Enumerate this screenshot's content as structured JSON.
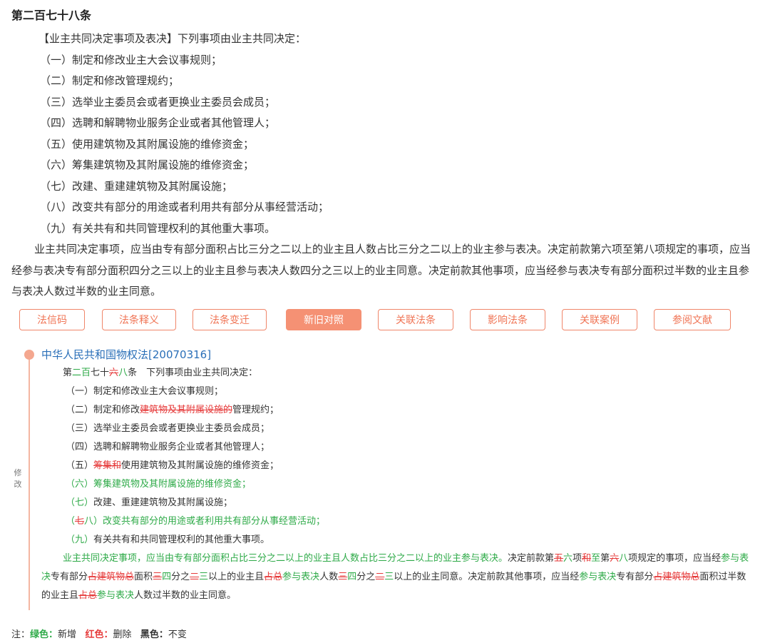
{
  "article": {
    "title": "第二百七十八条",
    "intro": "【业主共同决定事项及表决】下列事项由业主共同决定：",
    "items": [
      "（一）制定和修改业主大会议事规则；",
      "（二）制定和修改管理规约；",
      "（三）选举业主委员会或者更换业主委员会成员；",
      "（四）选聘和解聘物业服务企业或者其他管理人；",
      "（五）使用建筑物及其附属设施的维修资金；",
      "（六）筹集建筑物及其附属设施的维修资金；",
      "（七）改建、重建建筑物及其附属设施；",
      "（八）改变共有部分的用途或者利用共有部分从事经营活动；",
      "（九）有关共有和共同管理权利的其他重大事项。"
    ],
    "paragraph": "业主共同决定事项，应当由专有部分面积占比三分之二以上的业主且人数占比三分之二以上的业主参与表决。决定前款第六项至第八项规定的事项，应当经参与表决专有部分面积四分之三以上的业主且参与表决人数四分之三以上的业主同意。决定前款其他事项，应当经参与表决专有部分面积过半数的业主且参与表决人数过半数的业主同意。"
  },
  "tabs": [
    {
      "label": "法信码",
      "active": false
    },
    {
      "label": "法条释义",
      "active": false
    },
    {
      "label": "法条变迁",
      "active": false
    },
    {
      "label": "新旧对照",
      "active": true
    },
    {
      "label": "关联法条",
      "active": false
    },
    {
      "label": "影响法条",
      "active": false
    },
    {
      "label": "关联案例",
      "active": false
    },
    {
      "label": "参阅文献",
      "active": false
    }
  ],
  "comparison": {
    "side_label": "修改",
    "law_title": "中华人民共和国物权法[20070316]",
    "head": [
      {
        "t": "第"
      },
      {
        "t": "二百",
        "c": "g"
      },
      {
        "t": "七十"
      },
      {
        "t": "六",
        "c": "r"
      },
      {
        "t": "八",
        "c": "g"
      },
      {
        "t": "条　下列事项由业主共同决定："
      }
    ],
    "items": [
      [
        {
          "t": "（一）制定和修改业主大会议事规则；"
        }
      ],
      [
        {
          "t": "（二）制定和修改"
        },
        {
          "t": "建筑物及其附属设施的",
          "c": "r"
        },
        {
          "t": "管理规约；"
        }
      ],
      [
        {
          "t": "（三）选举业主委员会或者更换业主委员会成员；"
        }
      ],
      [
        {
          "t": "（四）选聘和解聘物业服务企业或者其他管理人；"
        }
      ],
      [
        {
          "t": "（五）"
        },
        {
          "t": "筹集和",
          "c": "r"
        },
        {
          "t": "使用建筑物及其附属设施的维修资金；"
        }
      ],
      [
        {
          "t": "（六）筹集建筑物及其附属设施的维修资金；",
          "c": "g"
        }
      ],
      [
        {
          "t": "（七）",
          "c": "g"
        },
        {
          "t": "改建、重建建筑物及其附属设施；"
        }
      ],
      [
        {
          "t": "（",
          "c": "g"
        },
        {
          "t": "七",
          "c": "r"
        },
        {
          "t": "八）改变共有部分的用途或者利用共有部分从事经营活动；",
          "c": "g"
        }
      ],
      [
        {
          "t": "（九）",
          "c": "g"
        },
        {
          "t": "有关共有和共同管理权利的其他重大事项。"
        }
      ]
    ],
    "paragraph": [
      {
        "t": "业主共同决定事项，应当由专有部分面积占比三分之二以上的业主且人数占比三分之二以上的业主参与表决。",
        "c": "g"
      },
      {
        "t": "决定前款第"
      },
      {
        "t": "五",
        "c": "r"
      },
      {
        "t": "六",
        "c": "g"
      },
      {
        "t": "项"
      },
      {
        "t": "和",
        "c": "r"
      },
      {
        "t": "至",
        "c": "g"
      },
      {
        "t": "第"
      },
      {
        "t": "六",
        "c": "r"
      },
      {
        "t": "八",
        "c": "g"
      },
      {
        "t": "项规定的事项，应当经"
      },
      {
        "t": "参与表决",
        "c": "g"
      },
      {
        "t": "专有部分"
      },
      {
        "t": "占建筑物总",
        "c": "r"
      },
      {
        "t": "面积"
      },
      {
        "t": "三",
        "c": "r"
      },
      {
        "t": "四",
        "c": "g"
      },
      {
        "t": "分之"
      },
      {
        "t": "二",
        "c": "r"
      },
      {
        "t": "三",
        "c": "g"
      },
      {
        "t": "以上的业主且"
      },
      {
        "t": "占总",
        "c": "r"
      },
      {
        "t": "参与表决",
        "c": "g"
      },
      {
        "t": "人数"
      },
      {
        "t": "三",
        "c": "r"
      },
      {
        "t": "四",
        "c": "g"
      },
      {
        "t": "分之"
      },
      {
        "t": "二",
        "c": "r"
      },
      {
        "t": "三",
        "c": "g"
      },
      {
        "t": "以上的业主同意。决定前款其他事项，应当经"
      },
      {
        "t": "参与表决",
        "c": "g"
      },
      {
        "t": "专有部分"
      },
      {
        "t": "占建筑物总",
        "c": "r"
      },
      {
        "t": "面积过半数的业主且"
      },
      {
        "t": "占总",
        "c": "r"
      },
      {
        "t": "参与表决",
        "c": "g"
      },
      {
        "t": "人数过半数的业主同意。"
      }
    ]
  },
  "legend": {
    "prefix": "注：",
    "green_label": "绿色：",
    "green_text": "新增",
    "red_label": "红色：",
    "red_text": "删除",
    "black_label": "黑色：",
    "black_text": "不变",
    "green_color": "#2eaa48",
    "red_color": "#e63b3b"
  }
}
